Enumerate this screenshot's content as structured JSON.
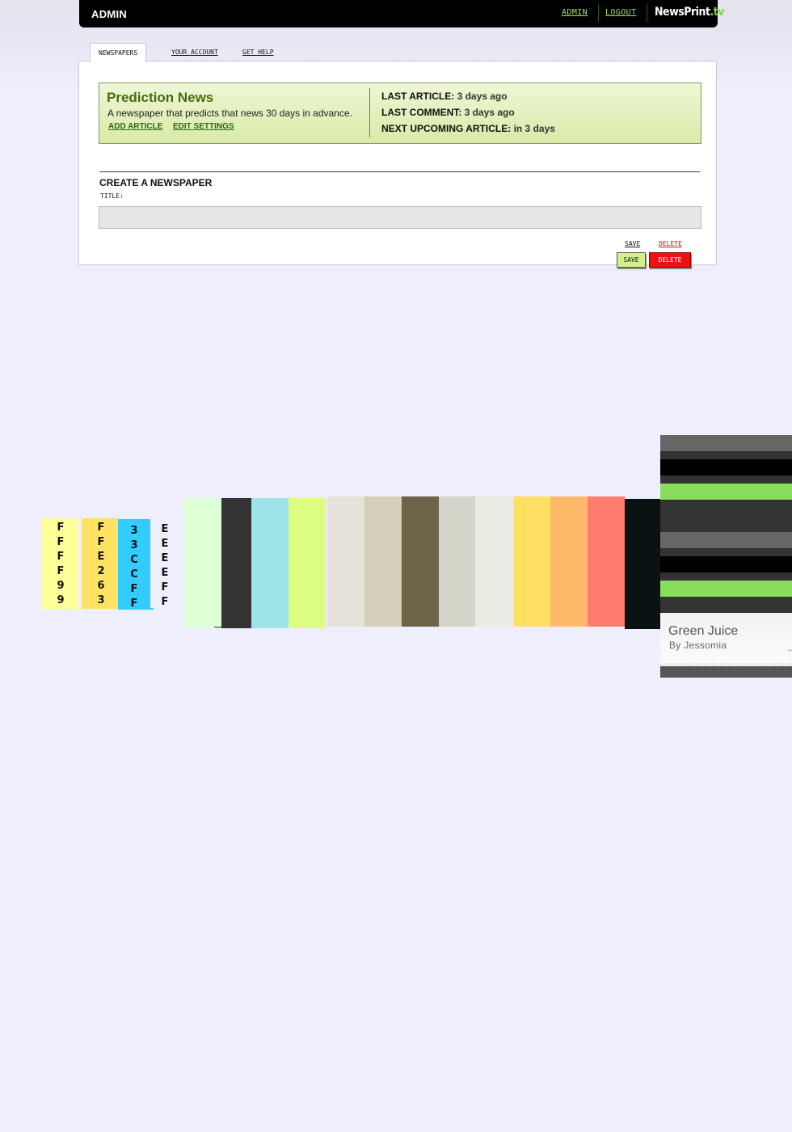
{
  "header": {
    "title": "ADMIN",
    "nav": [
      {
        "label": "ADMIN"
      },
      {
        "label": "LOGOUT"
      }
    ],
    "logo": {
      "name": "NewsPrint",
      "tld": ".tv"
    }
  },
  "tabs": [
    {
      "label": "NEWSPAPERS",
      "active": true
    },
    {
      "label": "YOUR ACCOUNT",
      "active": false
    },
    {
      "label": "GET HELP",
      "active": false
    }
  ],
  "newspaper": {
    "title": "Prediction News",
    "description": "A newspaper that predicts that news 30 days in advance.",
    "actions": [
      {
        "label": "ADD ARTICLE"
      },
      {
        "label": "EDIT SETTINGS"
      }
    ],
    "stats": [
      {
        "label": "LAST ARTICLE:",
        "value": "3 days ago"
      },
      {
        "label": "LAST COMMENT:",
        "value": "3 days ago"
      },
      {
        "label": "NEXT UPCOMING ARTICLE:",
        "value": "in 3 days"
      }
    ]
  },
  "create": {
    "heading": "CREATE A NEWSPAPER",
    "title_label": "TITLE:",
    "title_value": "",
    "save_link": "SAVE",
    "delete_link": "DELETE",
    "save_button": "SAVE",
    "delete_button": "DELETE"
  },
  "palette": {
    "hex_columns": [
      {
        "chars": [
          "F",
          "F",
          "F",
          "F",
          "9",
          "9"
        ],
        "color": "#FFFF99"
      },
      {
        "chars": [
          "F",
          "F",
          "E",
          "2",
          "6",
          "3"
        ],
        "color": "#FFE263"
      },
      {
        "chars": [
          "3",
          "3",
          "C",
          "C",
          "F",
          "F"
        ],
        "color": "#33CCFF"
      },
      {
        "chars": [
          "E",
          "E",
          "E",
          "E",
          "F",
          "F"
        ],
        "color": "#EEEEFF"
      }
    ],
    "strip_colors": [
      "#DDFFD6",
      "#333333",
      "#9DE4E8",
      "#DDFD82",
      "#E4E2D9",
      "#D5CEB8",
      "#6E6449",
      "#D4D5C8",
      "#EAEBE2",
      "#FFE063",
      "#FFB96B",
      "#FF7C6C",
      "#0B1213"
    ],
    "green_juice": {
      "title": "Green Juice",
      "author": "By Jessomia",
      "more": "..",
      "colors": [
        "#666666",
        "#333333",
        "#000000",
        "#88DD5C"
      ]
    }
  }
}
